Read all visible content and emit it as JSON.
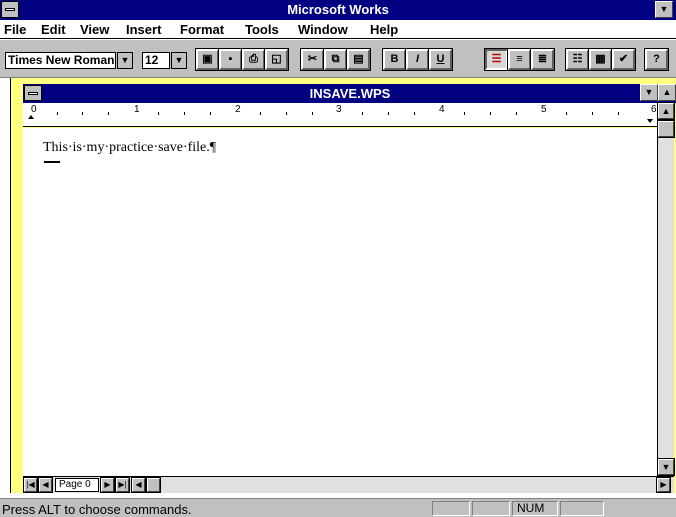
{
  "app": {
    "title": "Microsoft Works"
  },
  "menu": [
    "File",
    "Edit",
    "View",
    "Insert",
    "Format",
    "Tools",
    "Window",
    "Help"
  ],
  "toolbar": {
    "font_name": "Times New Roman",
    "font_size": "12",
    "bold_label": "B",
    "italic_label": "I",
    "underline_label": "U",
    "help_label": "?"
  },
  "document": {
    "title": "INSAVE.WPS",
    "text": "This·is·my·practice·save·file.¶",
    "ruler_numbers": [
      "0",
      "1",
      "2",
      "3",
      "4",
      "5",
      "6"
    ],
    "page_indicator": "Page 0"
  },
  "status": {
    "message": "Press ALT to choose commands.",
    "num_indicator": "NUM"
  },
  "colors": {
    "titlebar": "#000080",
    "workspace": "#ffff80",
    "toolbar": "#c0c0c0"
  }
}
